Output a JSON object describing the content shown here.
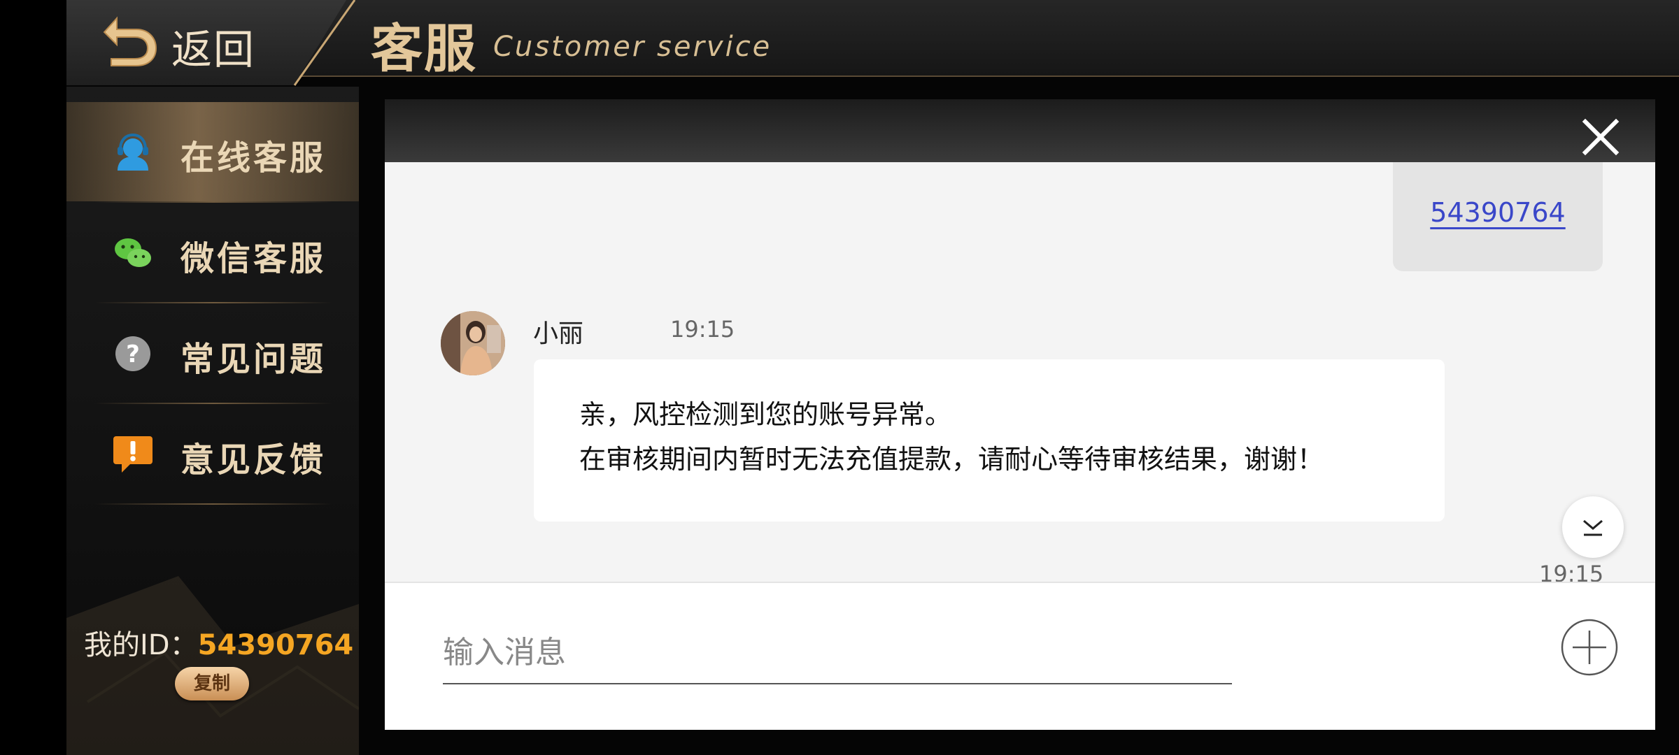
{
  "header": {
    "back_label": "返回",
    "title": "客服",
    "subtitle": "Customer service"
  },
  "sidebar": {
    "items": [
      {
        "label": "在线客服",
        "icon": "headset-user-icon",
        "active": true
      },
      {
        "label": "微信客服",
        "icon": "wechat-icon",
        "active": false
      },
      {
        "label": "常见问题",
        "icon": "question-icon",
        "active": false
      },
      {
        "label": "意见反馈",
        "icon": "exclamation-chat-icon",
        "active": false
      }
    ],
    "my_id_label": "我的ID：",
    "my_id_value": "54390764",
    "copy_label": "复制"
  },
  "chat": {
    "sent_message": "54390764",
    "agent_name": "小丽",
    "agent_time": "19:15",
    "agent_message_line1": "亲，风控检测到您的账号异常。",
    "agent_message_line2": "在审核期间内暂时无法充值提款，请耐心等待审核结果，谢谢！",
    "bottom_time": "19:15",
    "input_placeholder": "输入消息"
  },
  "colors": {
    "accent_gold": "#e3c79a",
    "id_orange": "#f5a623",
    "link_blue": "#3a47c9"
  }
}
